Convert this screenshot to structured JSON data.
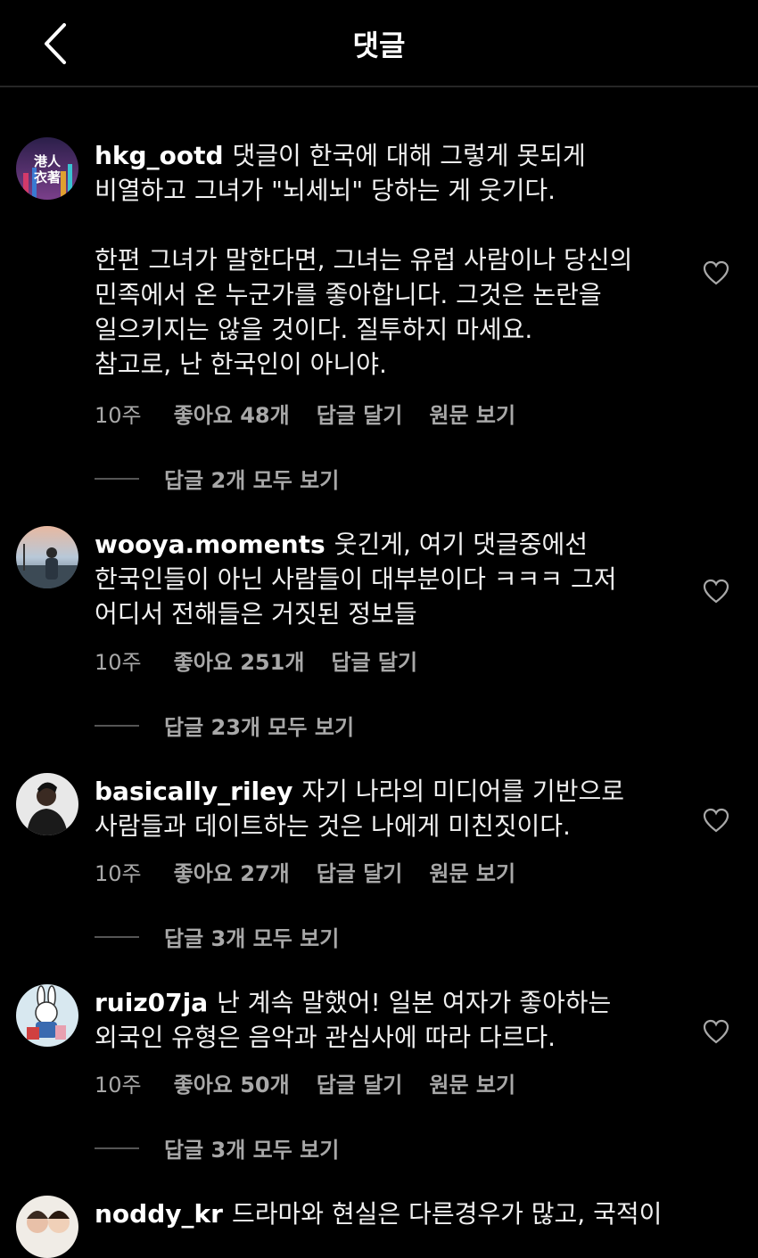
{
  "header": {
    "title": "댓글"
  },
  "comments": [
    {
      "username": "hkg_ootd",
      "text": "댓글이 한국에 대해 그렇게 못되게 비열하고 그녀가 \"뇌세뇌\" 당하는 게 웃기다.\n\n한편 그녀가 말한다면, 그녀는 유럽 사람이나 당신의 민족에서 온 누군가를 좋아합니다. 그것은 논란을 일으키지는 않을 것이다. 질투하지 마세요.\n참고로, 난 한국인이 아니야.",
      "time": "10주",
      "likes": "좋아요 48개",
      "reply": "답글 달기",
      "original": "원문 보기",
      "view_replies": "답글 2개 모두 보기",
      "avatar_text": "港人衣著"
    },
    {
      "username": "wooya.moments",
      "text": "웃긴게, 여기 댓글중에선 한국인들이 아닌 사람들이 대부분이다 ㅋㅋㅋ 그저 어디서 전해들은 거짓된 정보들",
      "time": "10주",
      "likes": "좋아요 251개",
      "reply": "답글 달기",
      "view_replies": "답글 23개 모두 보기"
    },
    {
      "username": "basically_riley",
      "text": "자기 나라의 미디어를 기반으로 사람들과 데이트하는 것은 나에게 미친짓이다.",
      "time": "10주",
      "likes": "좋아요 27개",
      "reply": "답글 달기",
      "original": "원문 보기",
      "view_replies": "답글 3개 모두 보기"
    },
    {
      "username": "ruiz07ja",
      "text": "난 계속 말했어! 일본 여자가 좋아하는 외국인 유형은 음악과 관심사에 따라 다르다.",
      "time": "10주",
      "likes": "좋아요 50개",
      "reply": "답글 달기",
      "original": "원문 보기",
      "view_replies": "답글 3개 모두 보기"
    },
    {
      "username": "noddy_kr",
      "text": "드라마와 현실은 다른경우가 많고, 국적이"
    }
  ],
  "icons": {
    "back": "chevron-left-icon",
    "like": "heart-outline-icon"
  },
  "colors": {
    "background": "#000000",
    "text": "#f5f5f5",
    "muted": "#a8a8a8",
    "divider": "#262626"
  }
}
